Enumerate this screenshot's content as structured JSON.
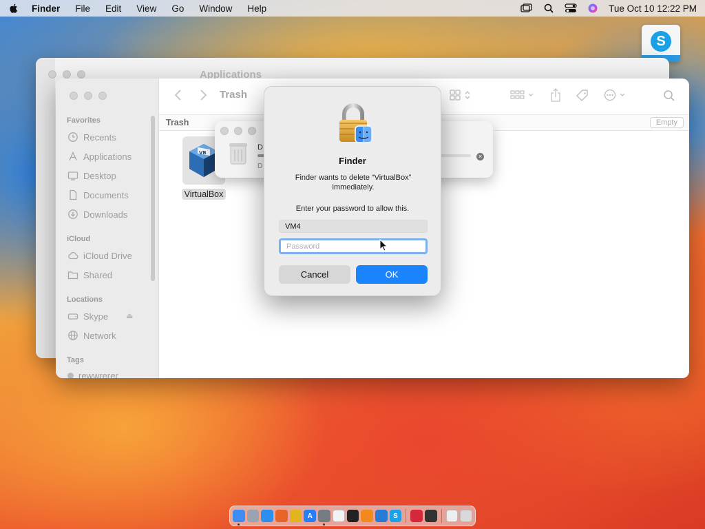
{
  "menubar": {
    "app_name": "Finder",
    "items": [
      "File",
      "Edit",
      "View",
      "Go",
      "Window",
      "Help"
    ],
    "clock": "Tue Oct 10  12:22 PM",
    "icons": [
      "screen-mirroring-icon",
      "search-icon",
      "control-center-icon",
      "siri-icon"
    ]
  },
  "desktop": {
    "skype_icon": "S"
  },
  "back_window": {
    "title": "Applications"
  },
  "trash_window": {
    "title": "Trash",
    "path_label": "Trash",
    "empty_button": "Empty",
    "sidebar": {
      "favorites_title": "Favorites",
      "favorites": [
        "Recents",
        "Applications",
        "Desktop",
        "Documents",
        "Downloads"
      ],
      "icloud_title": "iCloud",
      "icloud": [
        "iCloud Drive",
        "Shared"
      ],
      "locations_title": "Locations",
      "locations": [
        "Skype",
        "Network"
      ],
      "tags_title": "Tags",
      "tags": [
        "rewwrerer"
      ]
    },
    "file": {
      "name": "VirtualBox",
      "icon": "virtualbox-icon"
    }
  },
  "progress_popup": {
    "title_partial": "D",
    "sub_partial": "D",
    "progress": 0.1
  },
  "auth_dialog": {
    "title": "Finder",
    "message": "Finder wants to delete “VirtualBox” immediately.",
    "prompt": "Enter your password to allow this.",
    "username": "VM4",
    "password_placeholder": "Password",
    "cancel_label": "Cancel",
    "ok_label": "OK"
  },
  "dock": {
    "apps": [
      {
        "name": "finder",
        "color": "#3d8df5",
        "label": "",
        "running": true
      },
      {
        "name": "launchpad",
        "color": "#9aa3b1",
        "label": "",
        "running": false
      },
      {
        "name": "safari",
        "color": "#2b8ff0",
        "label": "",
        "running": false
      },
      {
        "name": "firefox",
        "color": "#e8652a",
        "label": "",
        "running": false
      },
      {
        "name": "chrome",
        "color": "#e2b51f",
        "label": "",
        "running": false
      },
      {
        "name": "app-store",
        "color": "#2a7ef5",
        "label": "A",
        "running": false
      },
      {
        "name": "system-settings",
        "color": "#777b82",
        "label": "",
        "running": true
      },
      {
        "name": "textedit",
        "color": "#f2f2f2",
        "label": "",
        "running": false
      },
      {
        "name": "terminal",
        "color": "#222222",
        "label": "",
        "running": false
      },
      {
        "name": "garageband",
        "color": "#f08a1c",
        "label": "",
        "running": false
      },
      {
        "name": "vscode",
        "color": "#2a7bd6",
        "label": "",
        "running": false
      },
      {
        "name": "skype",
        "color": "#1aa1e6",
        "label": "S",
        "running": false
      },
      {
        "name": "parallels",
        "color": "#d5283a",
        "label": "",
        "running": false
      },
      {
        "name": "piano-app",
        "color": "#333333",
        "label": "",
        "running": false
      },
      {
        "name": "downloads-stack",
        "color": "#eeeeee",
        "label": "",
        "running": false
      },
      {
        "name": "trash",
        "color": "#d9d9d9",
        "label": "",
        "running": false
      }
    ]
  }
}
